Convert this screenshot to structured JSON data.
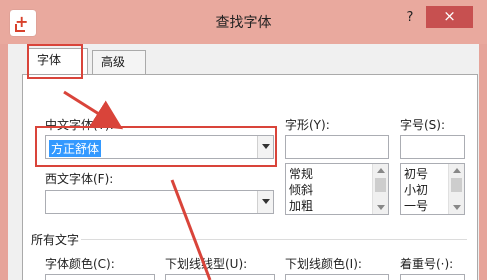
{
  "window": {
    "title": "查找字体",
    "help_label": "?",
    "close_label": "×"
  },
  "tabs": [
    {
      "label": "字体(N)"
    },
    {
      "label": "高级(V)"
    }
  ],
  "font_tab": {
    "chinese_font_label": "中文字体(T):",
    "chinese_font_value": "方正舒体",
    "western_font_label": "西文字体(F):",
    "western_font_value": "",
    "style_label": "字形(Y):",
    "style_value": "",
    "style_options": [
      "常规",
      "倾斜",
      "加粗"
    ],
    "size_label": "字号(S):",
    "size_value": "",
    "size_options": [
      "初号",
      "小初",
      "一号"
    ],
    "all_text_section": "所有文字",
    "font_color_label": "字体颜色(C):",
    "underline_style_label": "下划线线型(U):",
    "underline_color_label": "下划线颜色(I):",
    "emphasis_label": "着重号(·):"
  },
  "annotations": {
    "color": "#d9443a"
  }
}
